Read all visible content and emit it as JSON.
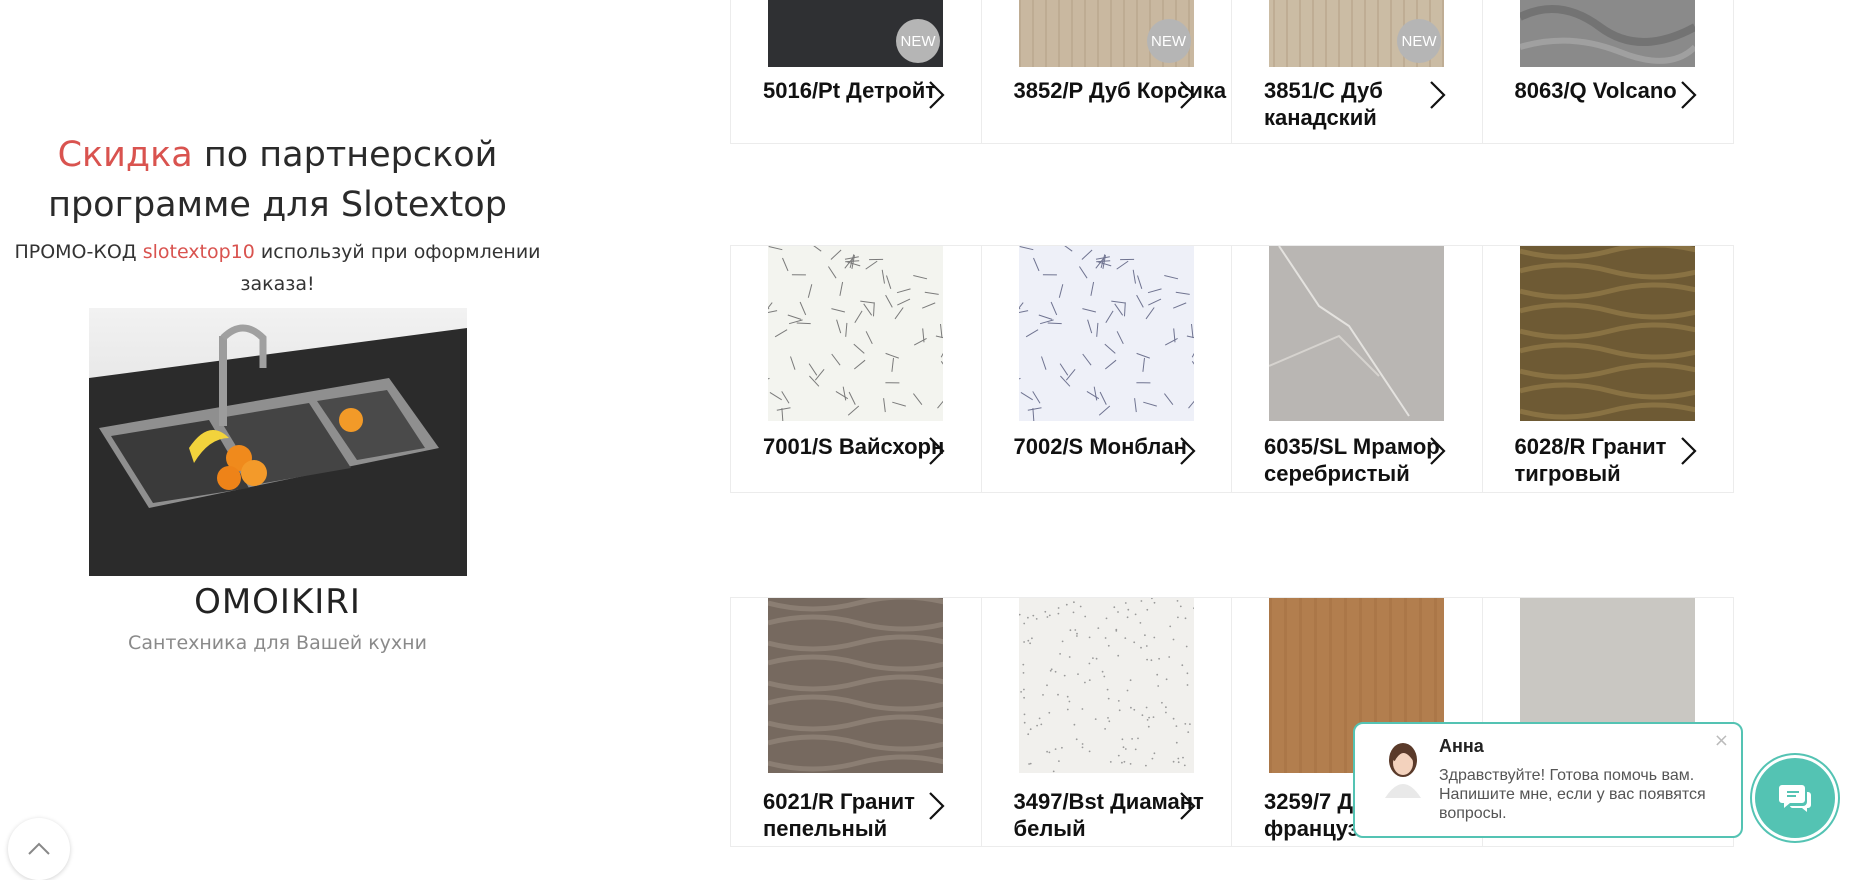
{
  "promo": {
    "title_accent": "Скидка",
    "title_rest": " по партнерской программе для Slotextop",
    "code_prefix": "ПРОМО-КОД ",
    "code": "slotextop10",
    "code_suffix": " используй при оформлении заказа!",
    "brand": "OMOIKIRI",
    "subtitle": "Сантехника для Вашей кухни"
  },
  "badge_label": "NEW",
  "products": [
    [
      {
        "name": "5016/Pt Детройт",
        "badge": true,
        "swatch": "#2f3033"
      },
      {
        "name": "3852/P Дуб Корсика",
        "badge": true,
        "swatch": "#c9b8a0"
      },
      {
        "name": "3851/C Дуб канадский",
        "badge": true,
        "swatch": "#cbbca4"
      },
      {
        "name": "8063/Q Volcano",
        "badge": false,
        "swatch": "#8a8a8a"
      }
    ],
    [
      {
        "name": "7001/S Вайсхорн",
        "badge": false,
        "swatch": "#f3f4ef"
      },
      {
        "name": "7002/S Монблан",
        "badge": false,
        "swatch": "#eef0f8"
      },
      {
        "name": "6035/SL Мрамор серебристый",
        "badge": false,
        "swatch": "#b9b6b3"
      },
      {
        "name": "6028/R Гранит тигровый",
        "badge": false,
        "swatch": "#6e5a34"
      }
    ],
    [
      {
        "name": "6021/R Гранит пепельный",
        "badge": false,
        "swatch": "#76695f"
      },
      {
        "name": "3497/Bst Диамант белый",
        "badge": false,
        "swatch": "#f1f0ed"
      },
      {
        "name": "3259/7 Дуб французский",
        "badge": false,
        "swatch": "#b27e4e"
      },
      {
        "name": "",
        "badge": false,
        "swatch": "#c9c7c2"
      }
    ]
  ],
  "chat": {
    "name": "Анна",
    "message": "Здравствуйте! Готова помочь вам. Напишите мне, если у вас появятся вопросы.",
    "close": "×"
  },
  "colors": {
    "accent": "#d9534f",
    "chat": "#54c3b3"
  }
}
